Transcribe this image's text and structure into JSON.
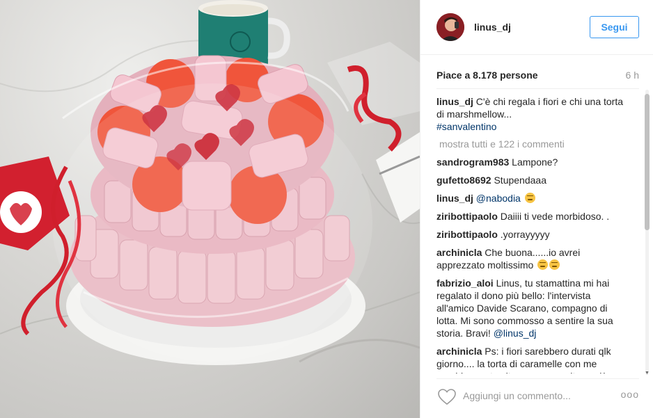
{
  "post": {
    "username": "linus_dj",
    "follow_label": "Segui",
    "likes": "Piace a 8.178 persone",
    "time_ago": "6 h",
    "photo_alt": "",
    "caption": {
      "user": "linus_dj",
      "text": "C'è chi regala i fiori e chi una torta di marshmellow...",
      "hashtag": "#sanvalentino"
    },
    "load_more": "mostra tutti e 122 i commenti",
    "comments": [
      {
        "user": "sandrogram983",
        "text": "Lampone?"
      },
      {
        "user": "gufetto8692",
        "text": "Stupendaaa"
      },
      {
        "user": "linus_dj",
        "mention": "@nabodia",
        "emoji": "smirk"
      },
      {
        "user": "ziribottipaolo",
        "text": "Daiiii ti vede morbidoso. ."
      },
      {
        "user": "ziribottipaolo",
        "text": ".yorrayyyyy"
      },
      {
        "user": "archinicla",
        "text": "Che buona......io avrei apprezzato moltissimo",
        "emoji": "grimace"
      },
      {
        "user": "fabrizio_aloi",
        "text": "Linus, tu stamattina mi hai regalato il dono più bello: l'intervista all'amico Davide Scarano, compagno di lotta. Mi sono commosso a sentire la sua storia. Bravi!",
        "mention": "@linus_dj"
      },
      {
        "user": "archinicla",
        "text": "Ps: i fiori sarebbero durati qlk giorno.... la torta di caramelle con me sarebbe avuto vita meeeeeeooltooo più breve"
      }
    ],
    "comment_placeholder": "Aggiungi un commento...",
    "more_options": "ooo"
  },
  "colors": {
    "accent": "#3897f0",
    "text": "#262626",
    "muted": "#999999",
    "hashtag": "#003569"
  }
}
